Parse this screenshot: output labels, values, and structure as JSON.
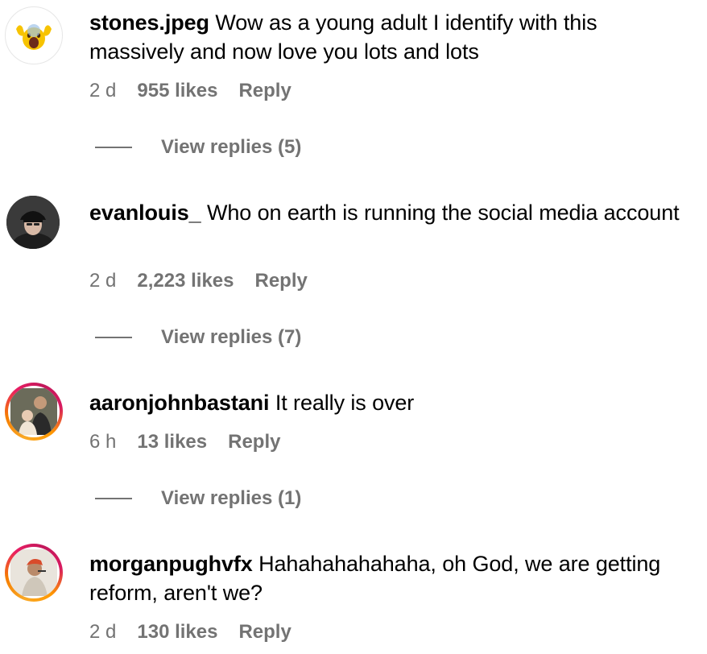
{
  "comments": [
    {
      "username": "stones.jpeg",
      "text": "Wow as a young adult I identify with this massively and now love you lots and lots",
      "time": "2 d",
      "likes": "955 likes",
      "reply_label": "Reply",
      "view_replies": "View replies (5)",
      "avatar_icon": "screaming-face-emoji-icon"
    },
    {
      "username": "evanlouis_",
      "text": "Who on earth is running the social media account",
      "time": "2 d",
      "likes": "2,223 likes",
      "reply_label": "Reply",
      "view_replies": "View replies (7)",
      "avatar_icon": "profile-photo-cap"
    },
    {
      "username": "aaronjohnbastani",
      "text": "It really is over",
      "time": "6 h",
      "likes": "13 likes",
      "reply_label": "Reply",
      "view_replies": "View replies (1)",
      "avatar_icon": "profile-photo-story-ring"
    },
    {
      "username": "morganpughvfx",
      "text": "Hahahahahahaha, oh God, we are getting reform, aren't we?",
      "time": "2 d",
      "likes": "130 likes",
      "reply_label": "Reply",
      "avatar_icon": "profile-photo-story-ring"
    }
  ],
  "colors": {
    "meta_text": "#737373",
    "story_ring_start": "#f9a825",
    "story_ring_end": "#d81b60"
  }
}
